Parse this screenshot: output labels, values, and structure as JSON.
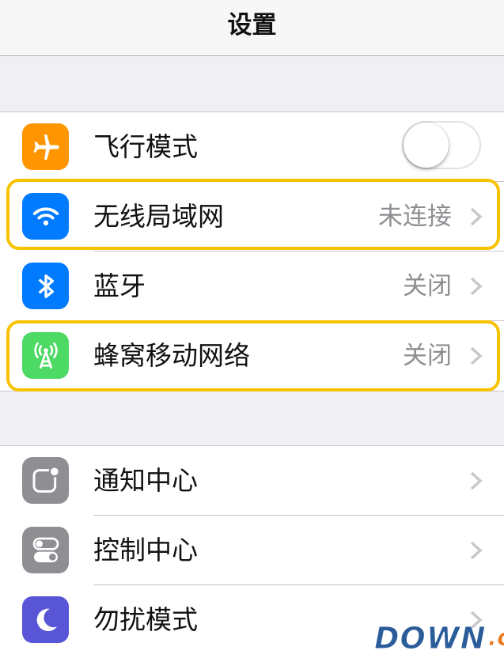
{
  "nav": {
    "title": "设置"
  },
  "group1": [
    {
      "label": "飞行模式",
      "icon": "airplane-icon",
      "color": "#ff9500",
      "toggle": false
    },
    {
      "label": "无线局域网",
      "icon": "wifi-icon",
      "color": "#007aff",
      "value": "未连接"
    },
    {
      "label": "蓝牙",
      "icon": "bluetooth-icon",
      "color": "#007aff",
      "value": "关闭"
    },
    {
      "label": "蜂窝移动网络",
      "icon": "cellular-antenna-icon",
      "color": "#4cd964",
      "value": "关闭"
    }
  ],
  "group2": [
    {
      "label": "通知中心",
      "icon": "notification-center-icon",
      "color": "#8e8e93"
    },
    {
      "label": "控制中心",
      "icon": "control-center-icon",
      "color": "#8e8e93"
    },
    {
      "label": "勿扰模式",
      "icon": "moon-icon",
      "color": "#5856d6"
    }
  ],
  "highlight_color": "#f7c300",
  "watermark": {
    "main": "DOWN",
    "suffix": ".cc"
  }
}
